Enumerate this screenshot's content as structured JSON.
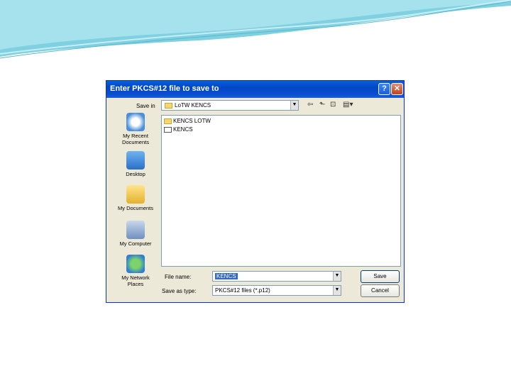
{
  "dialog": {
    "title": "Enter PKCS#12 file to save to",
    "help_glyph": "?",
    "close_glyph": "✕",
    "save_in_label": "Save in",
    "save_in_value": "LoTW KENCS",
    "places": [
      {
        "label": "My Recent Documents",
        "icon": "recent-documents-icon"
      },
      {
        "label": "Desktop",
        "icon": "desktop-icon"
      },
      {
        "label": "My Documents",
        "icon": "my-documents-icon"
      },
      {
        "label": "My Computer",
        "icon": "my-computer-icon"
      },
      {
        "label": "My Network Places",
        "icon": "network-places-icon"
      }
    ],
    "files": [
      {
        "name": "KENCS LOTW",
        "icon": "folder-icon"
      },
      {
        "name": "KENCS",
        "icon": "file-icon"
      }
    ],
    "file_name_label": "File name:",
    "file_name_value": "KENCS",
    "save_as_type_label": "Save as type:",
    "save_as_type_value": "PKCS#12 files (*.p12)",
    "save_button": "Save",
    "cancel_button": "Cancel"
  }
}
